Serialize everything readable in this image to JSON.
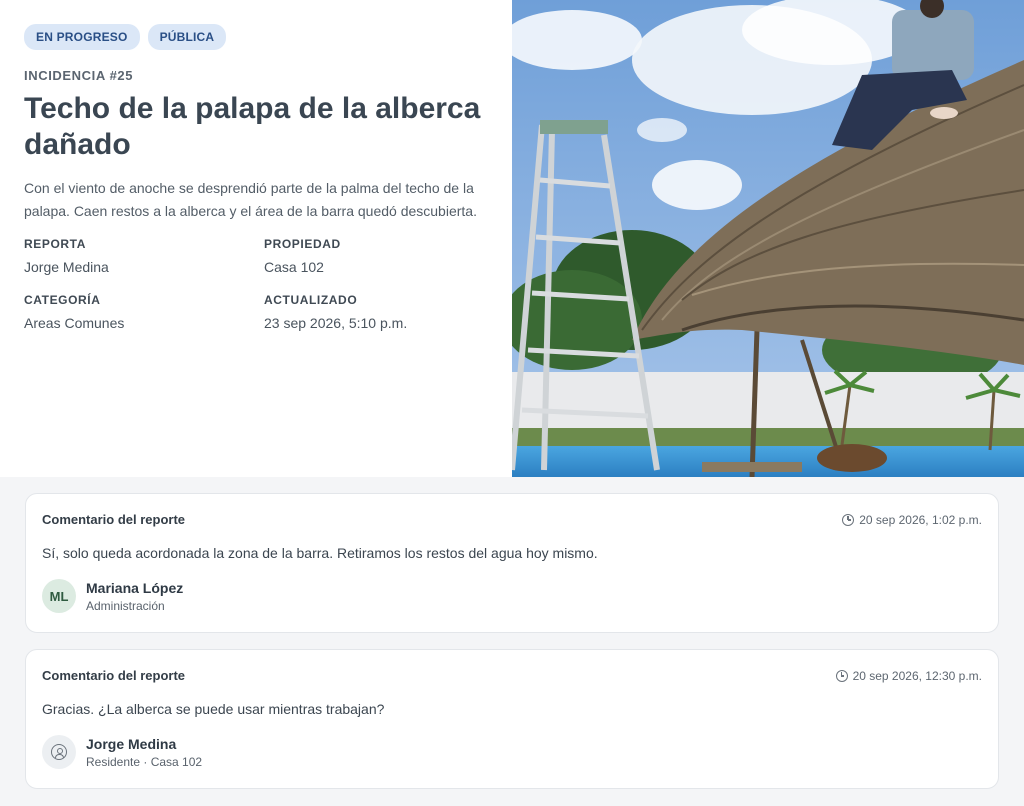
{
  "incident": {
    "badges": [
      "EN PROGRESO",
      "PÚBLICA"
    ],
    "eyebrow": "INCIDENCIA #25",
    "title": "Techo de la palapa de la alberca dañado",
    "description": "Con el viento de anoche se desprendió parte de la palma del techo de la palapa. Caen restos a la alberca y el área de la barra quedó descubierta.",
    "meta": {
      "reporta_label": "REPORTA",
      "reporta_value": "Jorge Medina",
      "propiedad_label": "PROPIEDAD",
      "propiedad_value": "Casa 102",
      "categoria_label": "CATEGORÍA",
      "categoria_value": "Areas Comunes",
      "actualizado_label": "ACTUALIZADO",
      "actualizado_value": "23 sep 2026, 5:10 p.m."
    }
  },
  "comments": [
    {
      "title": "Comentario del reporte",
      "date": "20 sep 2026, 1:02 p.m.",
      "text": "Sí, solo queda acordonada la zona de la barra. Retiramos los restos del agua hoy mismo.",
      "author": {
        "initials": "ML",
        "name": "Mariana López",
        "role": "Administración"
      }
    },
    {
      "title": "Comentario del reporte",
      "date": "20 sep 2026, 12:30 p.m.",
      "text": "Gracias. ¿La alberca se puede usar mientras trabajan?",
      "author": {
        "icon": "user-icon",
        "name": "Jorge Medina",
        "role": "Residente · Casa 102"
      }
    }
  ],
  "colors": {
    "badge_bg": "#dbe7f7",
    "badge_text": "#2a4f86",
    "avatar_bg": "#dcebe1",
    "page_bg": "#f4f5f7"
  }
}
